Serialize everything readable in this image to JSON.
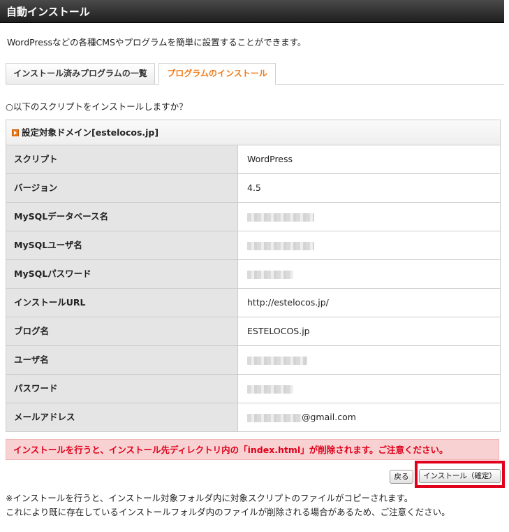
{
  "header": {
    "title": "自動インストール"
  },
  "intro": "WordPressなどの各種CMSやプログラムを簡単に設置することができます。",
  "tabs": [
    {
      "label": "インストール済みプログラムの一覧",
      "active": false
    },
    {
      "label": "プログラムのインストール",
      "active": true
    }
  ],
  "question": "○以下のスクリプトをインストールしますか？",
  "table": {
    "heading": "設定対象ドメイン[estelocos.jp]",
    "rows": [
      {
        "label": "スクリプト",
        "value": "WordPress"
      },
      {
        "label": "バージョン",
        "value": "4.5"
      },
      {
        "label": "MySQLデータベース名",
        "value": ""
      },
      {
        "label": "MySQLユーザ名",
        "value": ""
      },
      {
        "label": "MySQLパスワード",
        "value": ""
      },
      {
        "label": "インストールURL",
        "value": "http://estelocos.jp/"
      },
      {
        "label": "ブログ名",
        "value": "ESTELOCOS.jp"
      },
      {
        "label": "ユーザ名",
        "value": ""
      },
      {
        "label": "パスワード",
        "value": ""
      },
      {
        "label": "メールアドレス",
        "value": "@gmail.com"
      }
    ]
  },
  "warning": "インストールを行うと、インストール先ディレクトリ内の「index.html」が削除されます。ご注意ください。",
  "buttons": {
    "back": "戻る",
    "confirm": "インストール（確定）"
  },
  "notes": [
    "※インストールを行うと、インストール対象フォルダ内に対象スクリプトのファイルがコピーされます。",
    "これにより既に存在しているインストールフォルダ内のファイルが削除される場合があるため、ご注意ください。"
  ],
  "colors": {
    "accent": "#f07a16",
    "warning_text": "#e0001b",
    "highlight_border": "#e1001c"
  }
}
